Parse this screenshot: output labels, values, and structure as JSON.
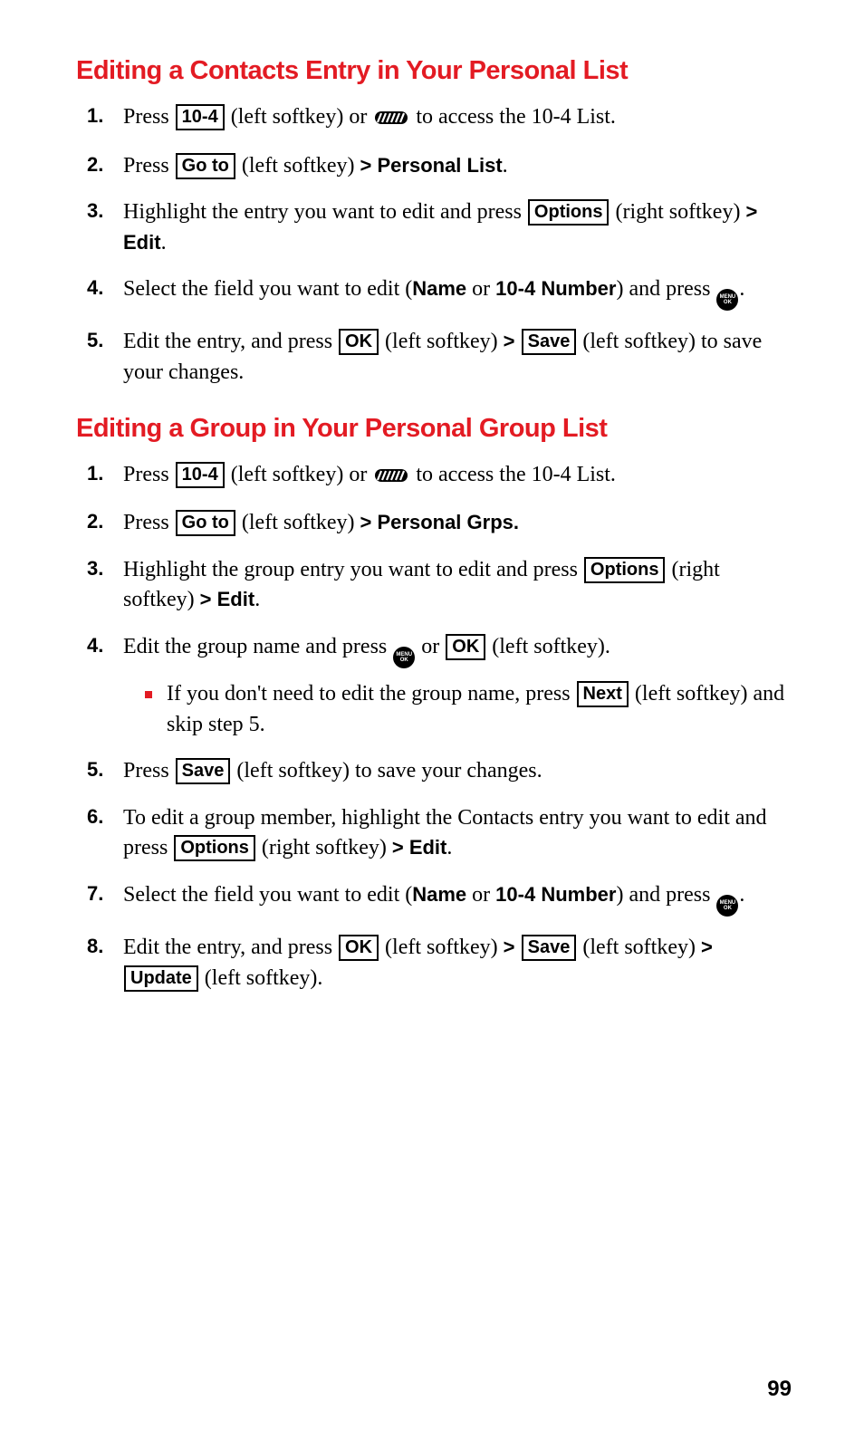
{
  "section_a": {
    "heading": "Editing a Contacts Entry in Your Personal List",
    "steps": {
      "s1": {
        "num": "1.",
        "t1": "Press ",
        "key_104": "10-4",
        "t2": " (left softkey) or ",
        "t3": " to access the 10-4 List."
      },
      "s2": {
        "num": "2.",
        "t1": "Press ",
        "key_goto": "Go to",
        "t2": " (left softkey) ",
        "arrow": "> ",
        "b_personal": "Personal List",
        "t3": "."
      },
      "s3": {
        "num": "3.",
        "t1": "Highlight the entry you want to edit and press ",
        "key_options": "Options",
        "t2": " (right softkey) ",
        "arrow": "> ",
        "b_edit": "Edit",
        "t3": "."
      },
      "s4": {
        "num": "4.",
        "t1": "Select the field you want to edit (",
        "b_name": "Name",
        "t2": " or ",
        "b_104num": "10-4 Number",
        "t3": ") and press ",
        "t4": "."
      },
      "s5": {
        "num": "5.",
        "t1": "Edit the entry, and press ",
        "key_ok": "OK",
        "t2": " (left softkey) ",
        "arrow1": "> ",
        "key_save": "Save",
        "t3": " (left softkey) to save your changes."
      }
    }
  },
  "section_b": {
    "heading": "Editing a Group in Your Personal Group List",
    "steps": {
      "s1": {
        "num": "1.",
        "t1": "Press ",
        "key_104": "10-4",
        "t2": " (left softkey) or ",
        "t3": " to access the 10-4 List."
      },
      "s2": {
        "num": "2.",
        "t1": "Press ",
        "key_goto": "Go to",
        "t2": " (left softkey) ",
        "arrow": "> ",
        "b_personalgrps": "Personal Grps."
      },
      "s3": {
        "num": "3.",
        "t1": "Highlight the group entry you want to edit and press ",
        "key_options": "Options",
        "t2": " (right softkey) ",
        "arrow": "> ",
        "b_edit": "Edit",
        "t3": "."
      },
      "s4": {
        "num": "4.",
        "t1": "Edit the group name and press ",
        "t2": " or ",
        "key_ok": "OK",
        "t3": " (left softkey).",
        "sub": {
          "t1": "If you don't need to edit the group name, press ",
          "key_next": "Next",
          "t2": " (left softkey) and skip step 5."
        }
      },
      "s5": {
        "num": "5.",
        "t1": "Press ",
        "key_save": "Save",
        "t2": " (left softkey) to save your changes."
      },
      "s6": {
        "num": "6.",
        "t1": "To edit a group member, highlight the Contacts entry you want to edit and press ",
        "key_options": "Options",
        "t2": " (right softkey) ",
        "arrow": "> ",
        "b_edit": "Edit",
        "t3": "."
      },
      "s7": {
        "num": "7.",
        "t1": "Select the field you want to edit (",
        "b_name": "Name",
        "t2": " or ",
        "b_104num": "10-4 Number",
        "t3": ") and press ",
        "t4": "."
      },
      "s8": {
        "num": "8.",
        "t1": "Edit the entry, and press ",
        "key_ok": "OK",
        "t2": " (left softkey) ",
        "arrow1": "> ",
        "key_save": "Save",
        "t3": " (left softkey) ",
        "arrow2": "> ",
        "key_update": "Update",
        "t4": " (left softkey)."
      }
    }
  },
  "menu_ok_label": "MENU\nOK",
  "page_number": "99"
}
